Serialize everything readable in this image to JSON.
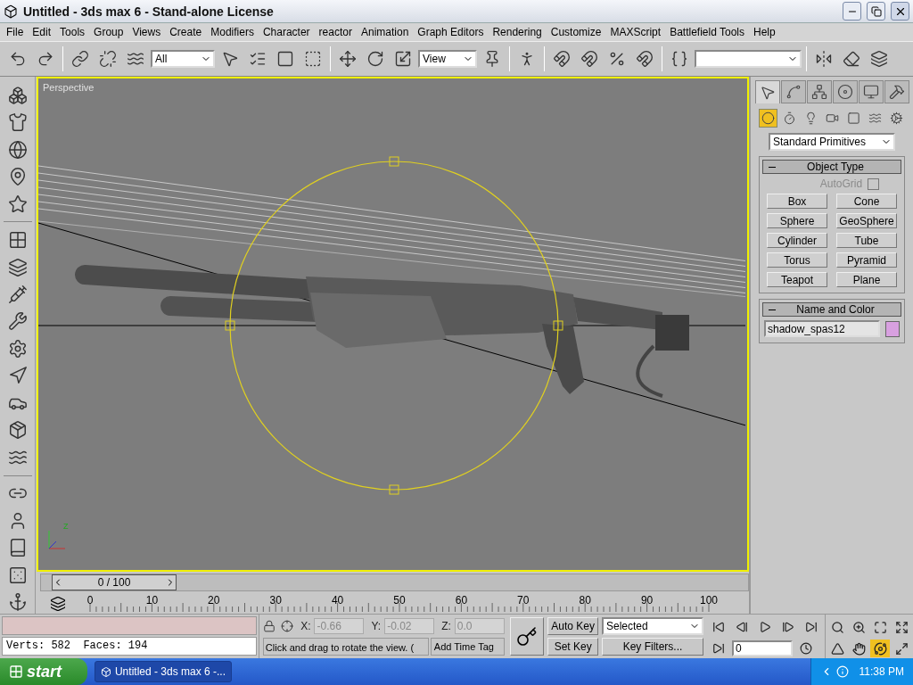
{
  "window": {
    "title": "Untitled - 3ds max 6 - Stand-alone License"
  },
  "menu": [
    "File",
    "Edit",
    "Tools",
    "Group",
    "Views",
    "Create",
    "Modifiers",
    "Character",
    "reactor",
    "Animation",
    "Graph Editors",
    "Rendering",
    "Customize",
    "MAXScript",
    "Battlefield Tools",
    "Help"
  ],
  "toolbar": {
    "selection_filter": "All",
    "reference_coordinates": "View"
  },
  "viewport": {
    "label": "Perspective",
    "axis_label": "Z"
  },
  "command_panel": {
    "tabs": [
      {
        "selected": true
      },
      {
        "selected": false
      },
      {
        "selected": false
      },
      {
        "selected": false
      },
      {
        "selected": false
      },
      {
        "selected": false
      }
    ],
    "categories": [
      {
        "selected": true
      },
      {
        "selected": false
      },
      {
        "selected": false
      },
      {
        "selected": false
      },
      {
        "selected": false
      },
      {
        "selected": false
      },
      {
        "selected": false
      }
    ],
    "object_category": "Standard Primitives",
    "object_type": {
      "title": "Object Type",
      "autogrid": {
        "label": "AutoGrid",
        "checked": false,
        "disabled": true
      },
      "buttons": [
        "Box",
        "Cone",
        "Sphere",
        "GeoSphere",
        "Cylinder",
        "Tube",
        "Torus",
        "Pyramid",
        "Teapot",
        "Plane"
      ]
    },
    "name_and_color": {
      "title": "Name and Color",
      "name": "shadow_spas12",
      "color": "#d8a0e0"
    }
  },
  "timeline": {
    "slider": {
      "label": "0 / 100",
      "level": 0
    },
    "ruler_labels": [
      "0",
      "10",
      "20",
      "30",
      "40",
      "50",
      "60",
      "70",
      "80",
      "90",
      "100"
    ]
  },
  "status": {
    "stats": "Verts: 582  Faces: 194",
    "coordinates": [
      {
        "axis": "X:",
        "value": "-0.66"
      },
      {
        "axis": "Y:",
        "value": "-0.02"
      },
      {
        "axis": "Z:",
        "value": "0.0"
      }
    ],
    "prompt": "Click and drag to rotate the view. (",
    "time_tag": "Add Time Tag",
    "auto_key": {
      "label": "Auto Key",
      "on": false
    },
    "set_key": "Set Key",
    "key_mode": "Selected",
    "key_filters": "Key Filters...",
    "current_frame": "0"
  },
  "taskbar": {
    "start": "start",
    "tasks": [
      {
        "label": "Untitled - 3ds max 6 -...",
        "selected": true
      }
    ],
    "clock": "11:38 PM"
  }
}
